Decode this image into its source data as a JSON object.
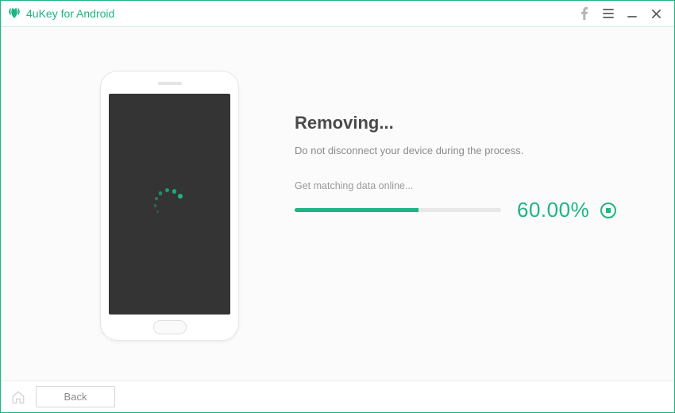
{
  "titlebar": {
    "app_name": "4uKey for Android"
  },
  "content": {
    "heading": "Removing...",
    "subtext": "Do not disconnect your device during the process.",
    "status": "Get matching data online...",
    "progress_pct_text": "60.00%",
    "progress_value": 60
  },
  "footer": {
    "back_label": "Back"
  },
  "colors": {
    "accent": "#1db583"
  }
}
